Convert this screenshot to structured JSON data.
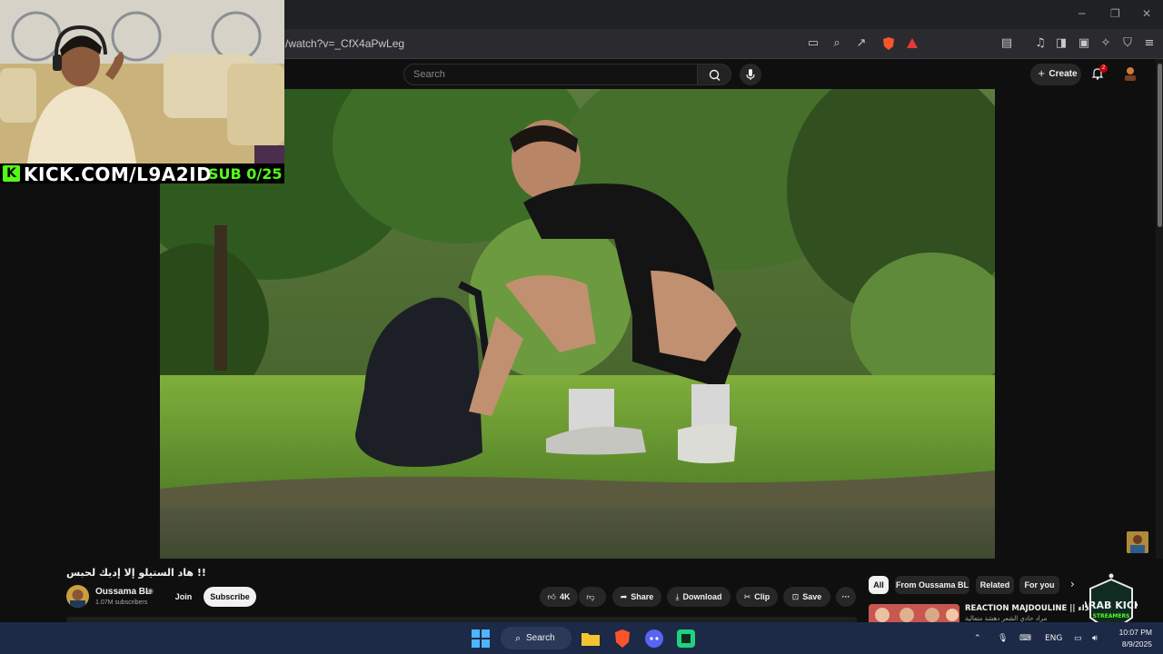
{
  "browser": {
    "url": "/watch?v=_CfX4aPwLeg",
    "window_controls": {
      "minimize": "─",
      "restore": "❐",
      "close": "✕"
    }
  },
  "youtube_header": {
    "search_placeholder": "Search",
    "create_label": "Create",
    "notification_count": "2"
  },
  "stream_overlay": {
    "kick_logo_letter": "K",
    "kick_url": "KICK.COM/L9A2ID",
    "sub_goal": "SUB 0/25"
  },
  "video_info": {
    "title": "هاد الستيلو إلا إديك لحبس !!",
    "channel_name": "Oussama BL",
    "subscribers": "1.07M subscribers",
    "join_label": "Join",
    "subscribe_label": "Subscribe",
    "like_count": "4K",
    "share_label": "Share",
    "download_label": "Download",
    "clip_label": "Clip",
    "save_label": "Save",
    "more_label": "···"
  },
  "chips": [
    {
      "label": "All",
      "active": true
    },
    {
      "label": "From Oussama BL",
      "active": false
    },
    {
      "label": "Related",
      "active": false
    },
    {
      "label": "For you",
      "active": false
    }
  ],
  "recommendation": {
    "title": "REACTION MAJDOULINE || أداء",
    "subtitle": "مراد حادي الشعر دهشة متعالية"
  },
  "taskbar": {
    "search_label": "Search",
    "language": "ENG",
    "time": "10:07 PM",
    "date": "8/9/2025"
  },
  "watermark": {
    "line1": "ARAB KICK",
    "line2": "STREAMERS"
  },
  "colors": {
    "kick_green": "#53fc18",
    "youtube_bg": "#0f0f0f",
    "taskbar_bg": "#1c2a47"
  }
}
